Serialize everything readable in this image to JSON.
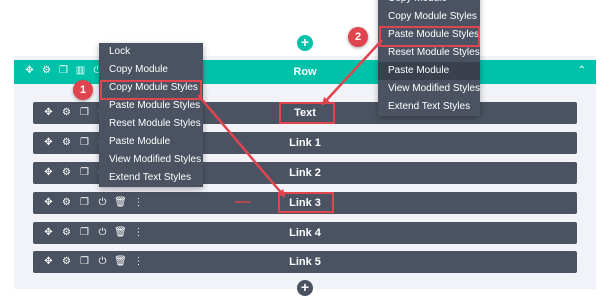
{
  "row": {
    "label": "Row"
  },
  "modules": [
    {
      "label": "Text"
    },
    {
      "label": "Link 1"
    },
    {
      "label": "Link 2"
    },
    {
      "label": "Link 3"
    },
    {
      "label": "Link 4"
    },
    {
      "label": "Link 5"
    }
  ],
  "left_menu": {
    "items": [
      "Lock",
      "Copy Module",
      "Copy Module Styles",
      "Paste Module Styles",
      "Reset Module Styles",
      "Paste Module",
      "View Modified Styles",
      "Extend Text Styles"
    ]
  },
  "right_menu": {
    "items": [
      "Copy Module",
      "Copy Module Styles",
      "Paste Module Styles",
      "Reset Module Styles",
      "Paste Module",
      "View Modified Styles",
      "Extend Text Styles"
    ]
  },
  "badges": {
    "one": "1",
    "two": "2"
  },
  "add_symbol": "+",
  "icons": {
    "move": "move-icon",
    "settings": "gear-icon",
    "duplicate": "duplicate-icon",
    "columns": "columns-icon",
    "power": "power-icon",
    "delete": "trash-icon",
    "more": "more-icon",
    "collapse": "chevron-up-icon"
  },
  "colors": {
    "row_accent": "#00c2a8",
    "module_bg": "#4b5362",
    "annotation_red": "#e0454f",
    "canvas_bg": "#f1f3f8"
  }
}
